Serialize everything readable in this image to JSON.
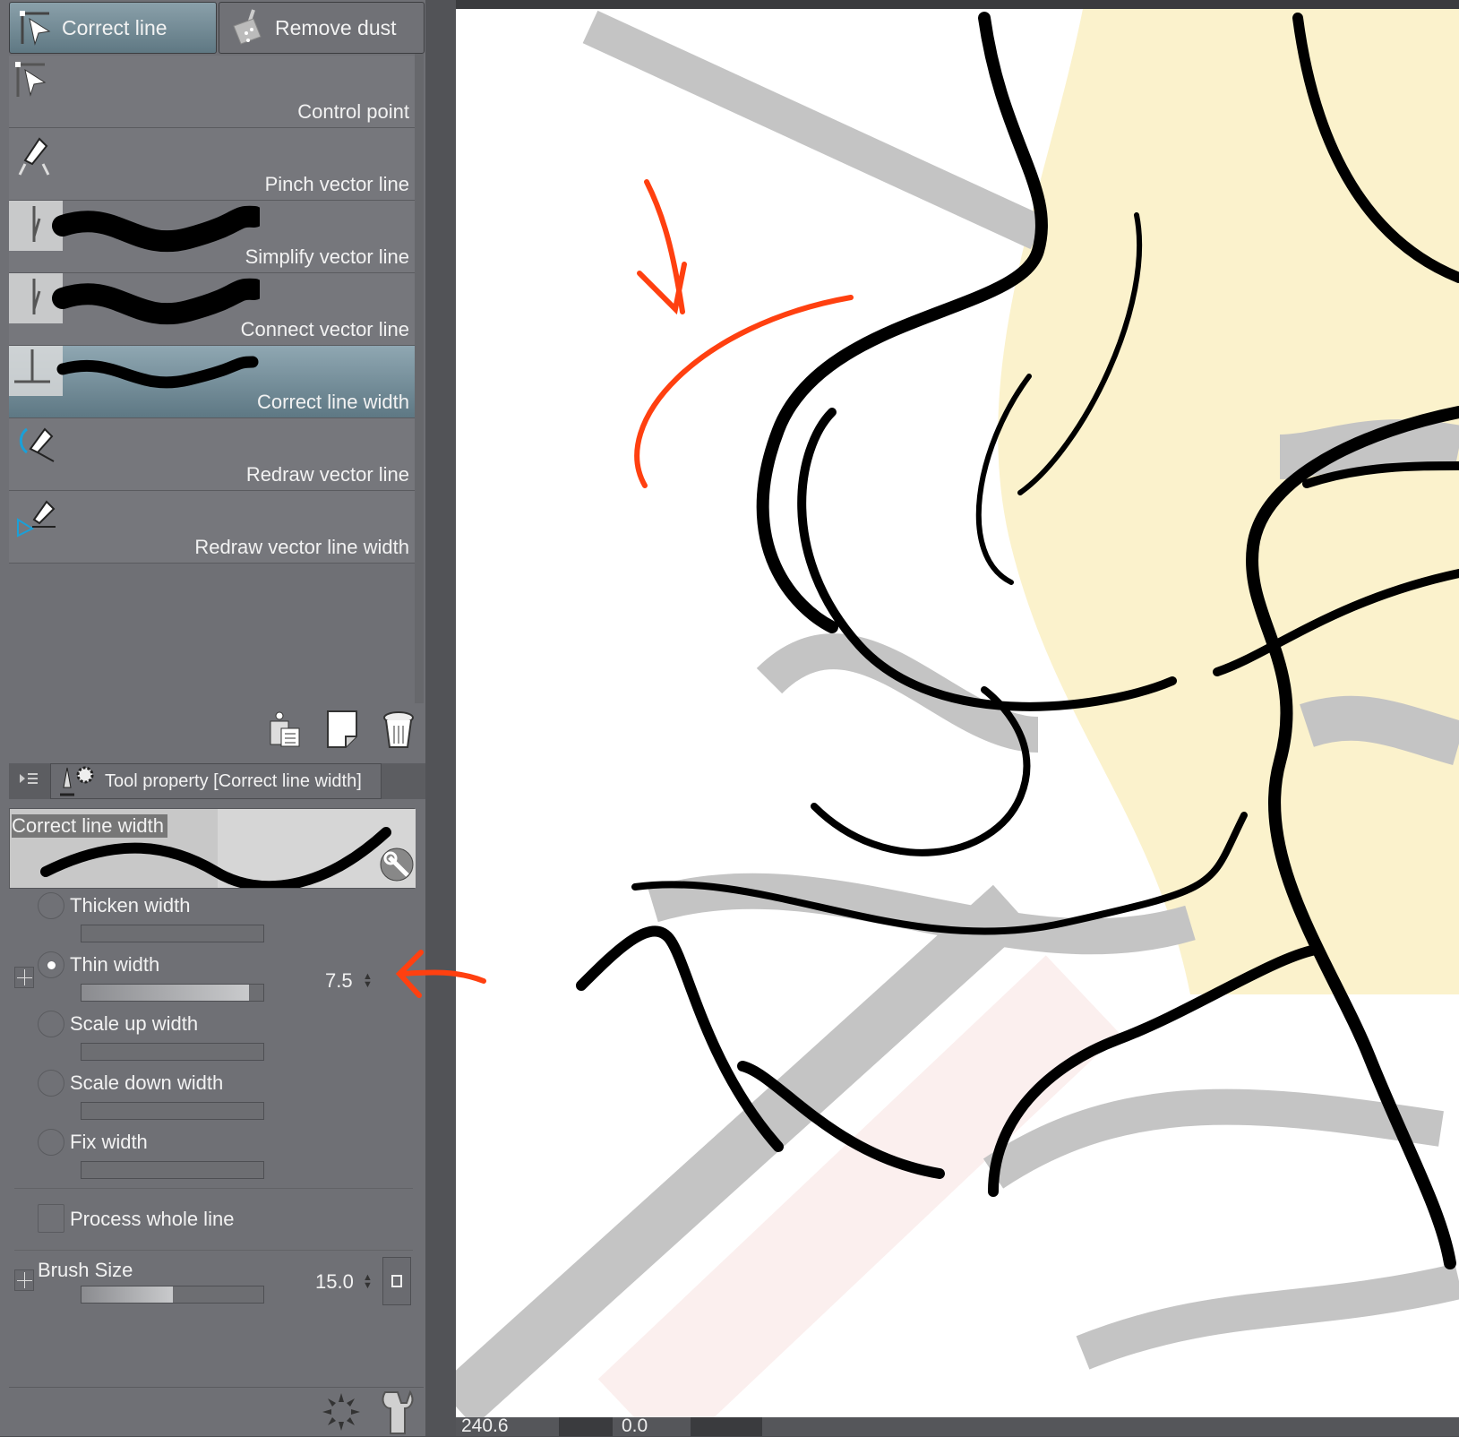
{
  "tabs": [
    {
      "label": "Correct line",
      "icon": "correct-line-icon",
      "active": true
    },
    {
      "label": "Remove dust",
      "icon": "dustpan-icon",
      "active": false
    }
  ],
  "tools": [
    {
      "label": "Control point",
      "icon": "control-point-icon"
    },
    {
      "label": "Pinch vector line",
      "icon": "pinch-pen-icon"
    },
    {
      "label": "Simplify vector line",
      "icon": "brush-stroke-icon"
    },
    {
      "label": "Connect vector line",
      "icon": "brush-stroke-icon"
    },
    {
      "label": "Correct line width",
      "icon": "brush-stroke-icon",
      "selected": true
    },
    {
      "label": "Redraw vector line",
      "icon": "redraw-pen-icon"
    },
    {
      "label": "Redraw vector line width",
      "icon": "redraw-width-icon"
    }
  ],
  "property": {
    "header": "Tool property [Correct line width]",
    "preview_label": "Correct line width",
    "options": [
      {
        "label": "Thicken width",
        "checked": false
      },
      {
        "label": "Thin width",
        "checked": true,
        "value": "7.5",
        "fill": 0.92
      },
      {
        "label": "Scale up width",
        "checked": false
      },
      {
        "label": "Scale down width",
        "checked": false
      },
      {
        "label": "Fix width",
        "checked": false
      }
    ],
    "process_whole_line": "Process whole line",
    "brush_size": {
      "label": "Brush Size",
      "value": "15.0",
      "fill": 0.5
    }
  },
  "status": {
    "left": "240.6",
    "right": "0.0"
  },
  "colors": {
    "accent": "#ff4010",
    "selected": "#6f8893"
  }
}
